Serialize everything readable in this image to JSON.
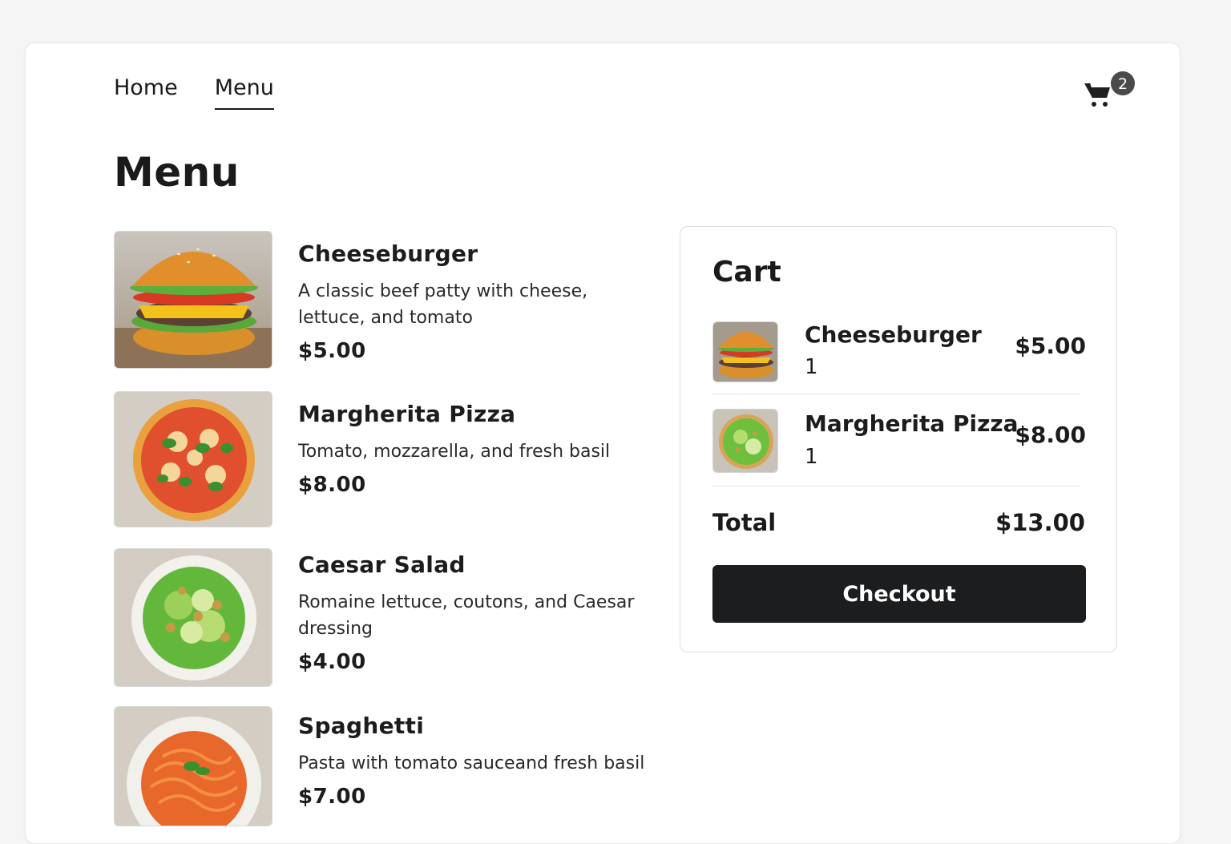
{
  "nav": {
    "links": [
      {
        "label": "Home",
        "active": false
      },
      {
        "label": "Menu",
        "active": true
      }
    ],
    "cart_count": "2"
  },
  "page": {
    "title": "Menu"
  },
  "menu": {
    "items": [
      {
        "name": "Cheeseburger",
        "description": "A classic beef patty with cheese, lettuce, and tomato",
        "price": "$5.00",
        "image": "cheeseburger-photo"
      },
      {
        "name": "Margherita Pizza",
        "description": "Tomato, mozzarella, and fresh basil",
        "price": "$8.00",
        "image": "margherita-pizza-photo"
      },
      {
        "name": "Caesar Salad",
        "description": "Romaine lettuce, coutons, and Caesar dressing",
        "price": "$4.00",
        "image": "caesar-salad-photo"
      },
      {
        "name": "Spaghetti",
        "description": "Pasta with tomato sauceand fresh basil",
        "price": "$7.00",
        "image": "spaghetti-photo"
      }
    ]
  },
  "cart": {
    "title": "Cart",
    "items": [
      {
        "name": "Cheeseburger",
        "quantity": "1",
        "price": "$5.00",
        "image": "cheeseburger-photo"
      },
      {
        "name": "Margherita Pizza",
        "quantity": "1",
        "price": "$8.00",
        "image": "salad-photo"
      }
    ],
    "total_label": "Total",
    "total_value": "$13.00",
    "checkout_label": "Checkout"
  },
  "colors": {
    "background": "#f5f5f5",
    "surface": "#ffffff",
    "text": "#1c1c1c",
    "button": "#1c1d1f",
    "badge": "#4a4a4a"
  }
}
